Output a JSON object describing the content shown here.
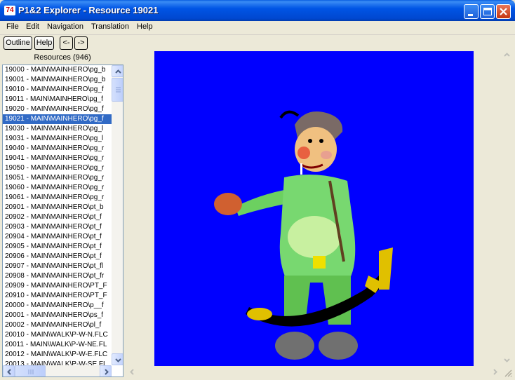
{
  "window": {
    "title": "P1&2 Explorer - Resource 19021",
    "app_icon_text": "74"
  },
  "menu": [
    "File",
    "Edit",
    "Navigation",
    "Translation",
    "Help"
  ],
  "toolbar": {
    "outline_label": "Outline",
    "help_label": "Help",
    "back_label": "<-",
    "forward_label": "->"
  },
  "resources": {
    "header": "Resources (946)",
    "selected_index": 5,
    "items": [
      "19000 - MAIN\\MAINHERO\\pg_b",
      "19001 - MAIN\\MAINHERO\\pg_b",
      "19010 - MAIN\\MAINHERO\\pg_f",
      "19011 - MAIN\\MAINHERO\\pg_f",
      "19020 - MAIN\\MAINHERO\\pg_f",
      "19021 - MAIN\\MAINHERO\\pg_f",
      "19030 - MAIN\\MAINHERO\\pg_l",
      "19031 - MAIN\\MAINHERO\\pg_l",
      "19040 - MAIN\\MAINHERO\\pg_r",
      "19041 - MAIN\\MAINHERO\\pg_r",
      "19050 - MAIN\\MAINHERO\\pg_r",
      "19051 - MAIN\\MAINHERO\\pg_r",
      "19060 - MAIN\\MAINHERO\\pg_r",
      "19061 - MAIN\\MAINHERO\\pg_r",
      "20901 - MAIN\\MAINHERO\\pt_b",
      "20902 - MAIN\\MAINHERO\\pt_f",
      "20903 - MAIN\\MAINHERO\\pt_f",
      "20904 - MAIN\\MAINHERO\\pt_f",
      "20905 - MAIN\\MAINHERO\\pt_f",
      "20906 - MAIN\\MAINHERO\\pt_f",
      "20907 - MAIN\\MAINHERO\\pt_fl",
      "20908 - MAIN\\MAINHERO\\pt_fr",
      "20909 - MAIN\\MAINHERO\\PT_F",
      "20910 - MAIN\\MAINHERO\\PT_F",
      "20000 - MAIN\\MAINHERO\\p__f",
      "20001 - MAIN\\MAINHERO\\ps_f",
      "20002 - MAIN\\MAINHERO\\pl_f",
      "20010 - MAIN\\WALK\\P-W-N.FLC",
      "20011 - MAIN\\WALK\\P-W-NE.FL",
      "20012 - MAIN\\WALK\\P-W-E.FLC",
      "20013 - MAIN\\WALK\\P-W-SE.FL"
    ]
  },
  "colors": {
    "canvas_background": "#0000ff",
    "selection": "#316ac5",
    "titlebar": "#0055e5"
  }
}
